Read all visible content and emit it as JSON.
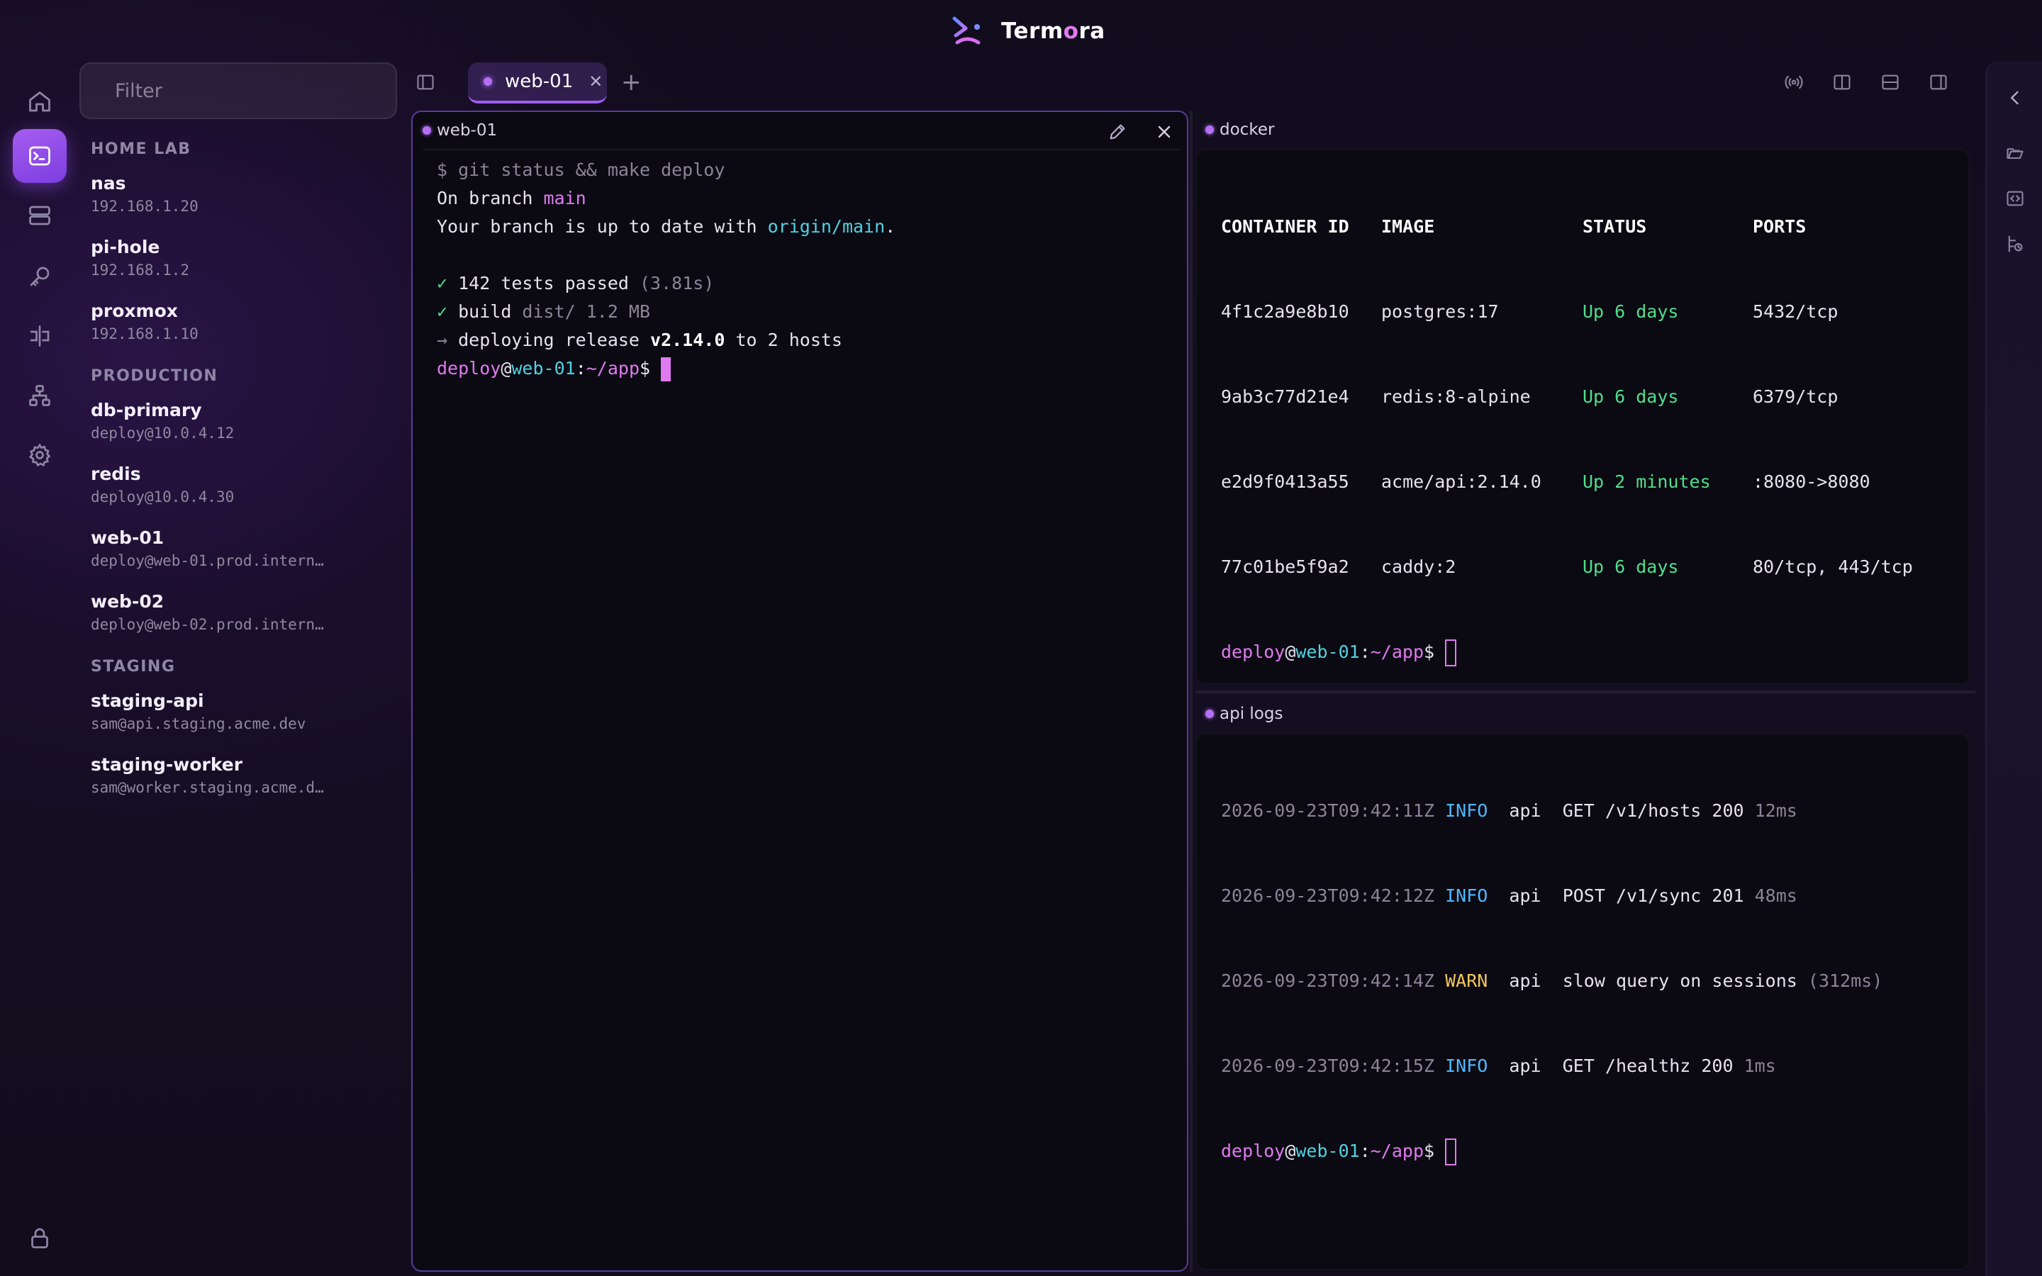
{
  "app": {
    "name_prefix": "Term",
    "name_accent": "o",
    "name_suffix": "ra",
    "logo_icon": "termora-logo-icon",
    "accent_color": "#a05cf0"
  },
  "rail": {
    "items": [
      {
        "icon": "home-icon"
      },
      {
        "icon": "terminal-icon",
        "active": true
      },
      {
        "icon": "servers-icon"
      },
      {
        "icon": "key-icon"
      },
      {
        "icon": "port-forward-icon"
      },
      {
        "icon": "network-icon"
      },
      {
        "icon": "gear-icon"
      },
      {
        "icon": "lock-icon"
      }
    ]
  },
  "sidebar": {
    "filter_placeholder": "Filter",
    "groups": [
      {
        "label": "HOME LAB",
        "hosts": [
          {
            "name": "nas",
            "address": "192.168.1.20"
          },
          {
            "name": "pi-hole",
            "address": "192.168.1.2"
          },
          {
            "name": "proxmox",
            "address": "192.168.1.10"
          }
        ]
      },
      {
        "label": "PRODUCTION",
        "hosts": [
          {
            "name": "db-primary",
            "address": "deploy@10.0.4.12"
          },
          {
            "name": "redis",
            "address": "deploy@10.0.4.30"
          },
          {
            "name": "web-01",
            "address": "deploy@web-01.prod.intern…"
          },
          {
            "name": "web-02",
            "address": "deploy@web-02.prod.intern…"
          }
        ]
      },
      {
        "label": "STAGING",
        "hosts": [
          {
            "name": "staging-api",
            "address": "sam@api.staging.acme.dev"
          },
          {
            "name": "staging-worker",
            "address": "sam@worker.staging.acme.d…"
          }
        ]
      }
    ]
  },
  "tabs": {
    "items": [
      {
        "label": "web-01",
        "close": "✕"
      }
    ],
    "add": "+"
  },
  "panes": {
    "main": {
      "title": "web-01",
      "cmd_prompt": "$ ",
      "cmd": "git status && make deploy",
      "line1_pre": "On branch ",
      "line1_branch": "main",
      "line2_pre": "Your branch is up to date with ",
      "line2_remote": "origin/main",
      "line2_post": ".",
      "check": "✓",
      "tests_pre": " 142 tests passed ",
      "tests_time": "(3.81s)",
      "build_pre": " build ",
      "build_info": "dist/ 1.2 MB",
      "arrow": "→",
      "deploy_pre": " deploying release ",
      "deploy_version": "v2.14.0",
      "deploy_post": " to 2 hosts"
    },
    "docker": {
      "title": "docker",
      "headers": [
        "CONTAINER ID",
        "IMAGE",
        "STATUS",
        "PORTS"
      ],
      "rows": [
        {
          "id": "4f1c2a9e8b10",
          "image": "postgres:17",
          "status": "Up 6 days",
          "ports": "5432/tcp"
        },
        {
          "id": "9ab3c77d21e4",
          "image": "redis:8-alpine",
          "status": "Up 6 days",
          "ports": "6379/tcp"
        },
        {
          "id": "e2d9f0413a55",
          "image": "acme/api:2.14.0",
          "status": "Up 2 minutes",
          "ports": ":8080->8080"
        },
        {
          "id": "77c01be5f9a2",
          "image": "caddy:2",
          "status": "Up 6 days",
          "ports": "80/tcp, 443/tcp"
        }
      ]
    },
    "logs": {
      "title": "api logs",
      "rows": [
        {
          "ts": "2026-09-23T09:42:11Z",
          "level": "INFO",
          "svc": "api",
          "msg": "GET /v1/hosts 200",
          "extra": "12ms"
        },
        {
          "ts": "2026-09-23T09:42:12Z",
          "level": "INFO",
          "svc": "api",
          "msg": "POST /v1/sync 201",
          "extra": "48ms"
        },
        {
          "ts": "2026-09-23T09:42:14Z",
          "level": "WARN",
          "svc": "api",
          "msg": "slow query on sessions",
          "extra": "(312ms)"
        },
        {
          "ts": "2026-09-23T09:42:15Z",
          "level": "INFO",
          "svc": "api",
          "msg": "GET /healthz 200",
          "extra": "1ms"
        }
      ]
    },
    "prompt": {
      "user": "deploy",
      "at": "@",
      "host": "web-01",
      "colon": ":",
      "path": "~/app",
      "dollar": "$ "
    }
  }
}
